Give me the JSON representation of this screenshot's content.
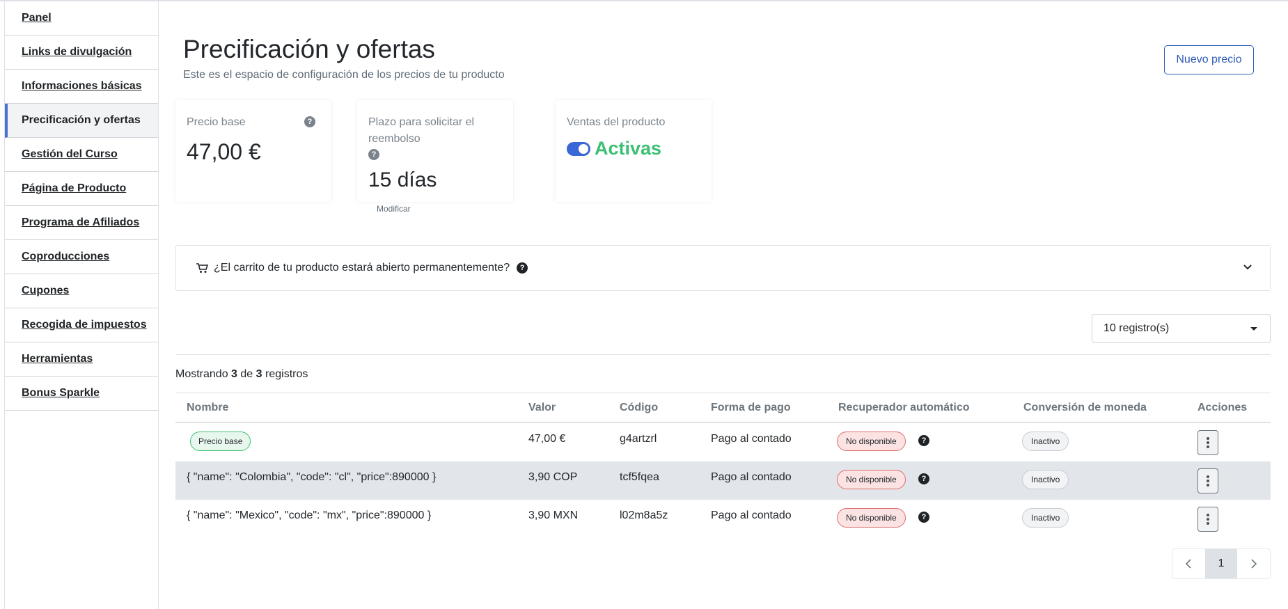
{
  "sidebar": {
    "items": [
      {
        "label": "Panel",
        "active": false
      },
      {
        "label": "Links de divulgación",
        "active": false
      },
      {
        "label": "Informaciones básicas",
        "active": false
      },
      {
        "label": "Precificación y ofertas",
        "active": true
      },
      {
        "label": "Gestión del Curso",
        "active": false
      },
      {
        "label": "Página de Producto",
        "active": false
      },
      {
        "label": "Programa de Afiliados",
        "active": false
      },
      {
        "label": "Coproducciones",
        "active": false
      },
      {
        "label": "Cupones",
        "active": false
      },
      {
        "label": "Recogida de impuestos",
        "active": false
      },
      {
        "label": "Herramientas",
        "active": false
      },
      {
        "label": "Bonus Sparkle",
        "active": false
      }
    ]
  },
  "header": {
    "title": "Precificación y ofertas",
    "subtitle": "Este es el espacio de configuración de los precios de tu producto",
    "new_price_button": "Nuevo precio"
  },
  "cards": {
    "base_price": {
      "label": "Precio base",
      "value": "47,00 €"
    },
    "refund": {
      "label": "Plazo para solicitar el reembolso",
      "value": "15 días",
      "modify_link": "Modificar"
    },
    "sales": {
      "label": "Ventas del producto",
      "status": "Activas",
      "enabled": true
    }
  },
  "cart_question": "¿El carrito de tu producto estará abierto permanentemente?",
  "page_size": {
    "selected": "10 registro(s)"
  },
  "showing": {
    "prefix": "Mostrando",
    "shown": "3",
    "mid": "de",
    "total": "3",
    "suffix": "registros"
  },
  "table": {
    "columns": [
      "Nombre",
      "Valor",
      "Código",
      "Forma de pago",
      "Recuperador automático",
      "Conversión de moneda",
      "Acciones"
    ],
    "rows": [
      {
        "name": "",
        "badge": "Precio base",
        "value": "47,00 €",
        "code": "g4artzrl",
        "payment": "Pago al contado",
        "recovery": "No disponible",
        "conversion": "Inactivo"
      },
      {
        "name": "{ \"name\": \"Colombia\", \"code\": \"cl\", \"price\":890000 }",
        "badge": "",
        "value": "3,90 COP",
        "code": "tcf5fqea",
        "payment": "Pago al contado",
        "recovery": "No disponible",
        "conversion": "Inactivo"
      },
      {
        "name": "{ \"name\": \"Mexico\", \"code\": \"mx\", \"price\":890000 }",
        "badge": "",
        "value": "3,90 MXN",
        "code": "l02m8a5z",
        "payment": "Pago al contado",
        "recovery": "No disponible",
        "conversion": "Inactivo"
      }
    ]
  },
  "pagination": {
    "current": "1"
  },
  "colors": {
    "accent": "#2f5bb7",
    "success": "#3bbf73",
    "danger": "#e06b6b",
    "toggle": "#3a67d6"
  }
}
